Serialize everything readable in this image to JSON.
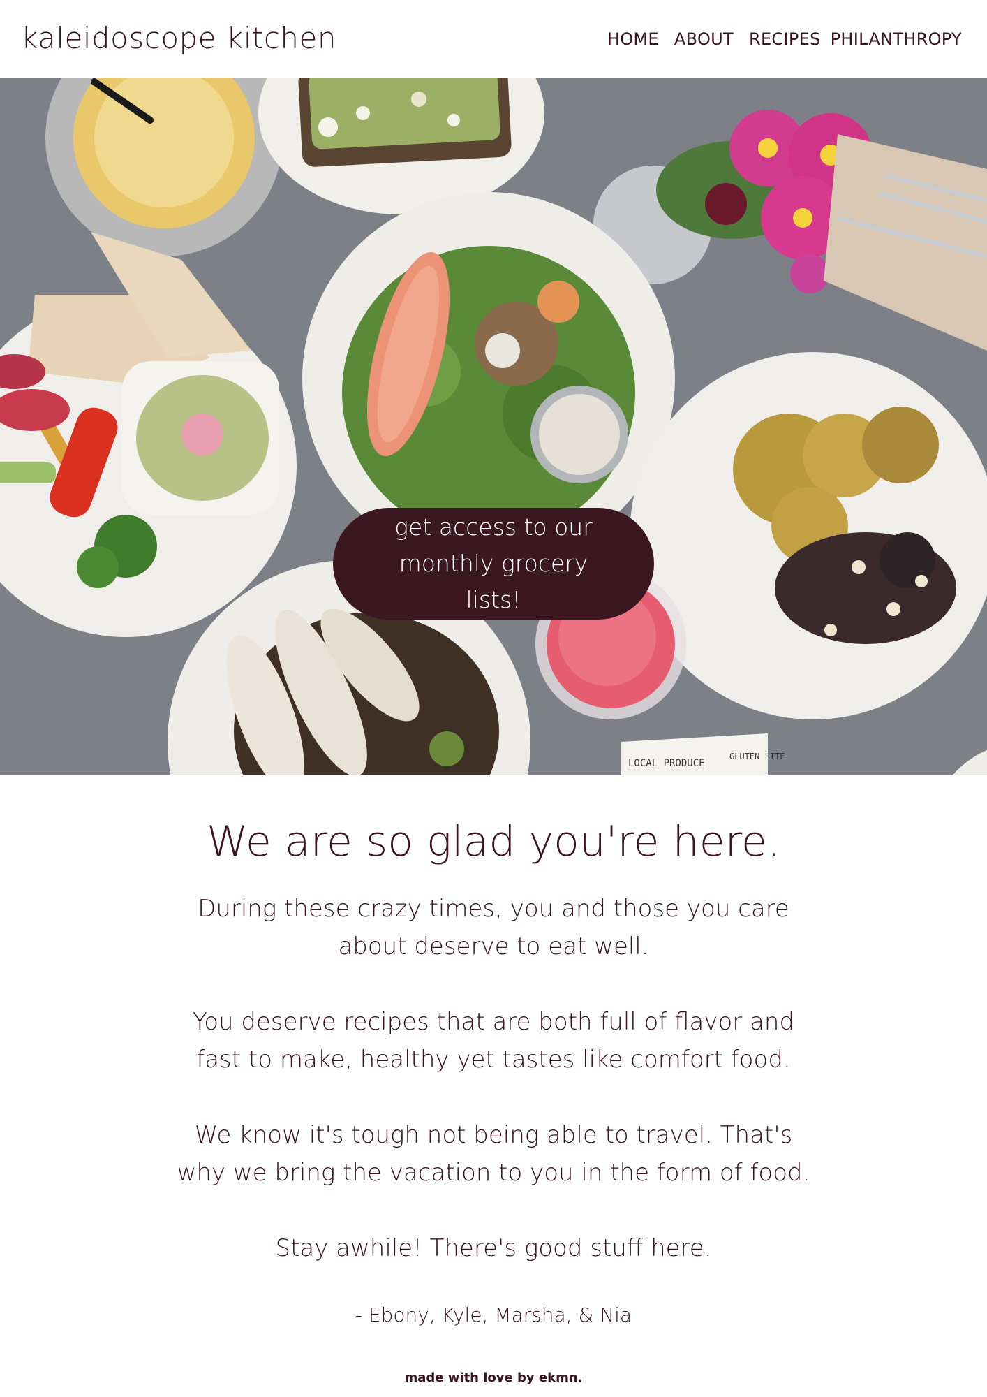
{
  "header": {
    "brand": "kaleidoscope kitchen",
    "nav": [
      "HOME",
      "ABOUT",
      "RECIPES",
      "PHILANTHROPY"
    ]
  },
  "hero": {
    "cta_label": "get access to our monthly grocery lists!",
    "card_text_left": "LOCAL PRODUCE",
    "card_text_right": "GLUTEN LITE"
  },
  "main": {
    "headline": "We are so glad you're here.",
    "paragraphs": [
      "During these crazy times, you and those you care about deserve to eat well.",
      "You deserve recipes that are both full of flavor and fast to make, healthy yet tastes like comfort food.",
      "We know it's tough not being able to travel. That's why we bring the vacation to you in the form of food.",
      "Stay awhile! There's good stuff here."
    ],
    "signature": "- Ebony, Kyle, Marsha, & Nia"
  },
  "footer": {
    "credit": "made with love by ekmn."
  },
  "colors": {
    "text": "#3a1420",
    "button": "#3b1721",
    "table": "#7d8187"
  }
}
